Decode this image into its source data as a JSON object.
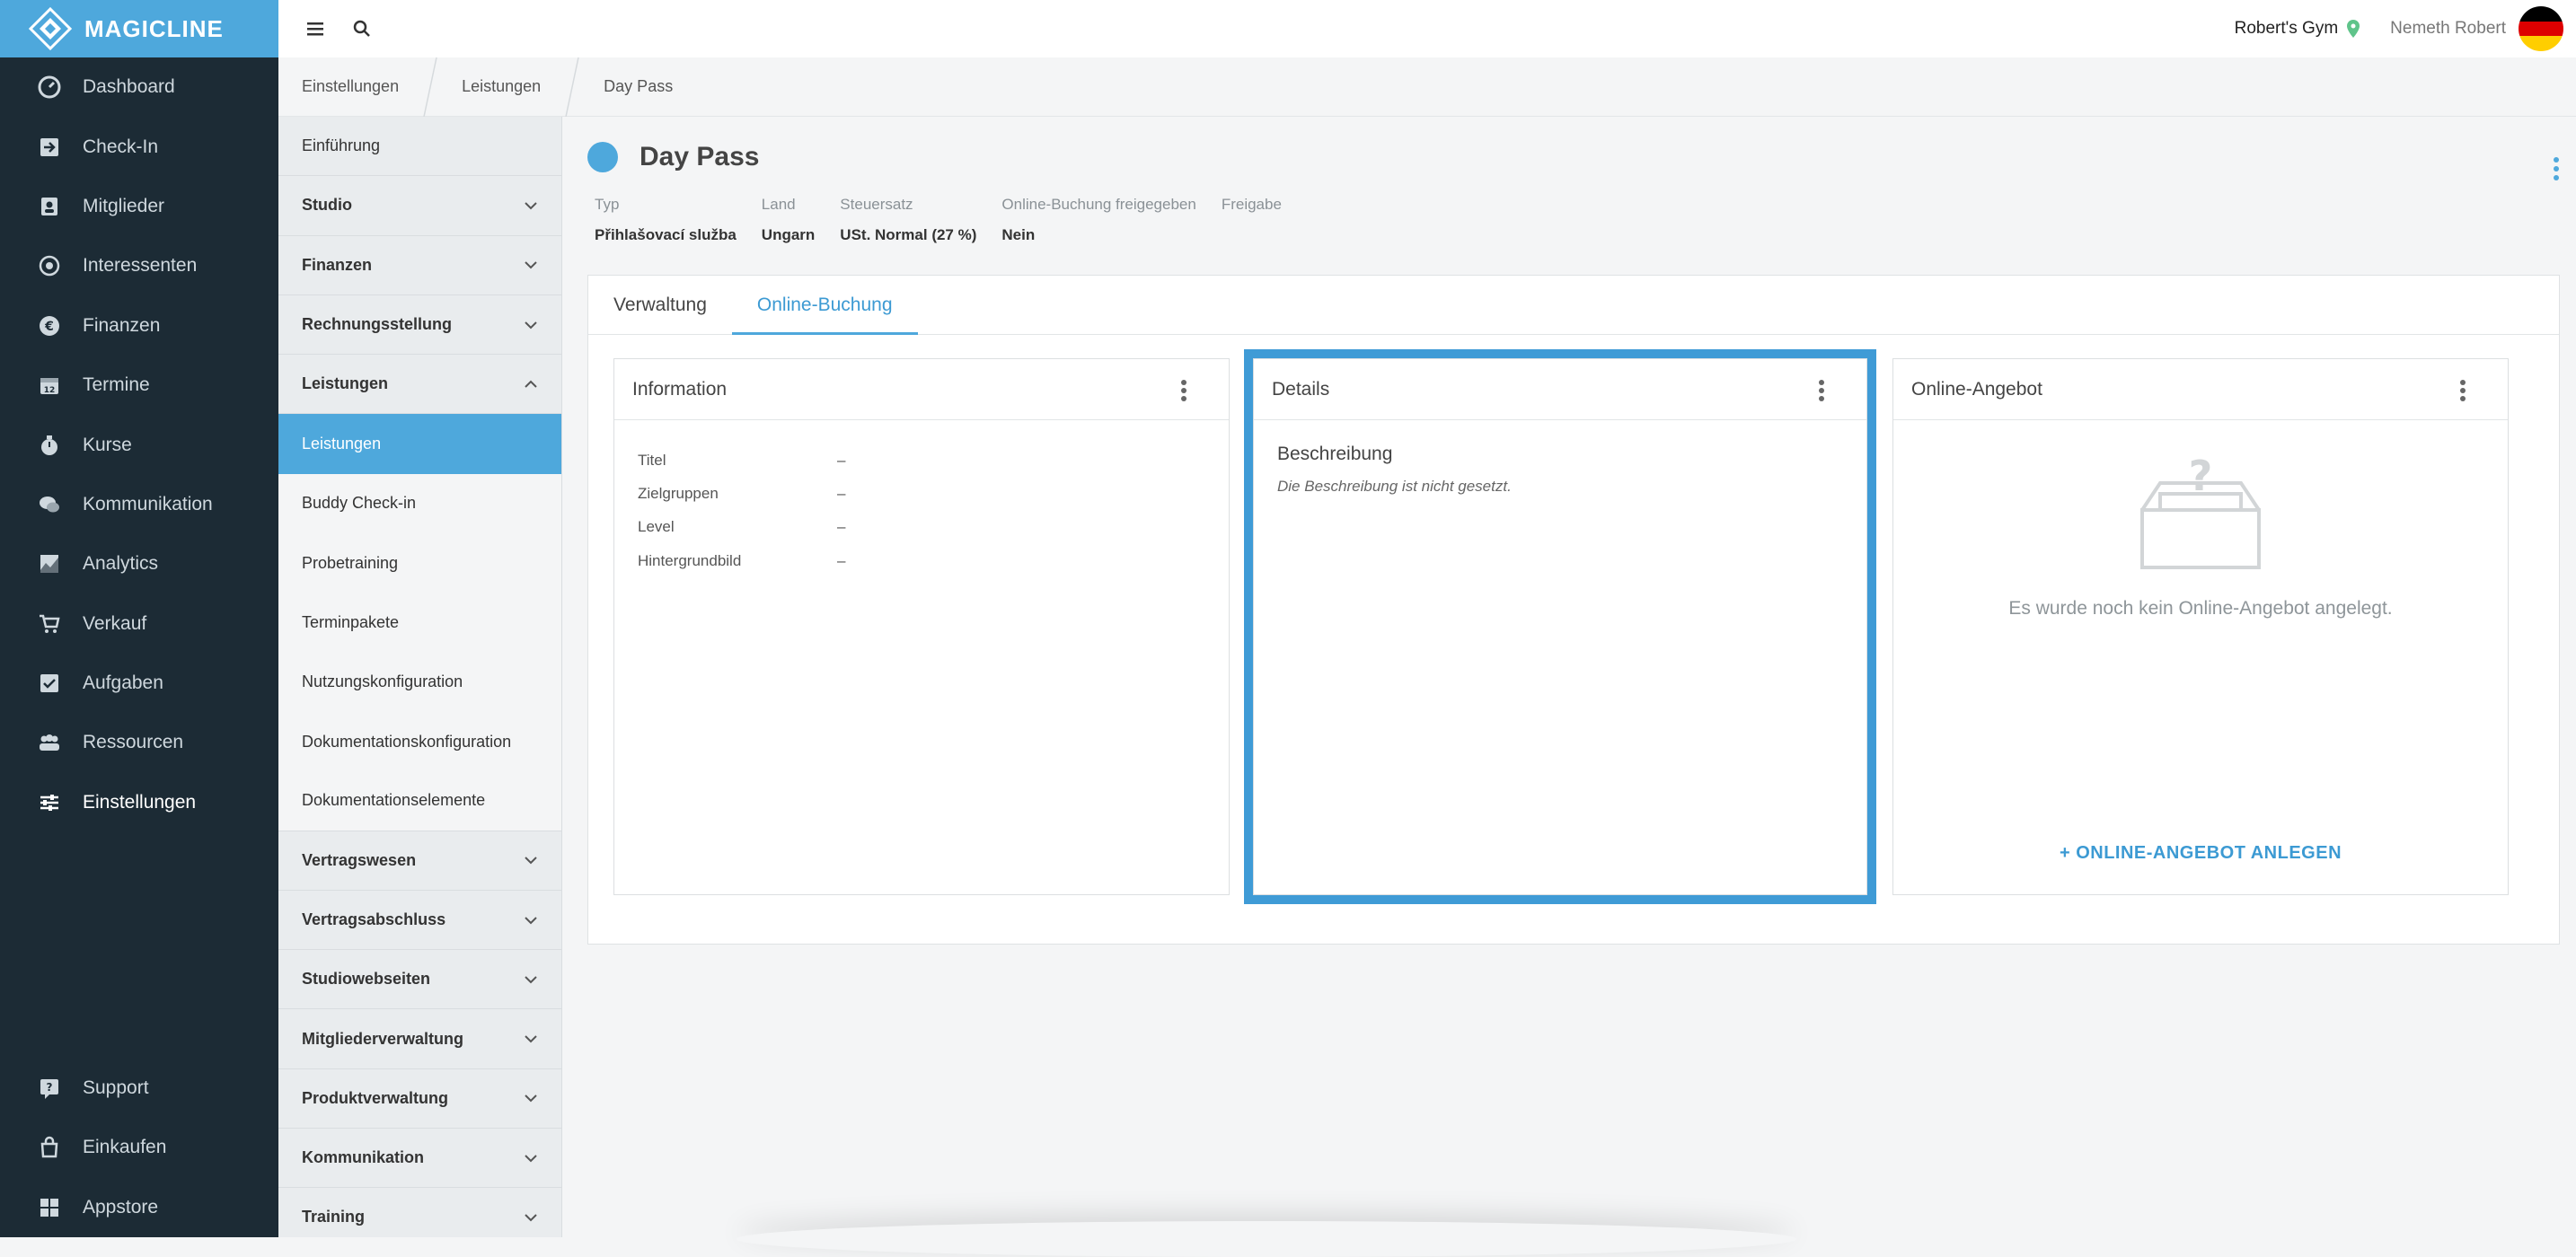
{
  "app": {
    "brand": "MAGICLINE"
  },
  "colors": {
    "accent": "#4ea8dc",
    "nav_bg": "#1c2b35",
    "link": "#3c9ad3"
  },
  "nav": {
    "items": [
      {
        "label": "Dashboard",
        "icon": "dashboard-icon"
      },
      {
        "label": "Check-In",
        "icon": "check-in-icon"
      },
      {
        "label": "Mitglieder",
        "icon": "members-icon"
      },
      {
        "label": "Interessenten",
        "icon": "prospects-icon"
      },
      {
        "label": "Finanzen",
        "icon": "euro-icon"
      },
      {
        "label": "Termine",
        "icon": "calendar-icon"
      },
      {
        "label": "Kurse",
        "icon": "courses-icon"
      },
      {
        "label": "Kommunikation",
        "icon": "chat-icon"
      },
      {
        "label": "Analytics",
        "icon": "analytics-icon"
      },
      {
        "label": "Verkauf",
        "icon": "cart-icon"
      },
      {
        "label": "Aufgaben",
        "icon": "tasks-icon"
      },
      {
        "label": "Ressourcen",
        "icon": "resources-icon"
      },
      {
        "label": "Einstellungen",
        "icon": "settings-icon"
      }
    ],
    "bottom": [
      {
        "label": "Support",
        "icon": "support-icon"
      },
      {
        "label": "Einkaufen",
        "icon": "shop-icon"
      },
      {
        "label": "Appstore",
        "icon": "appstore-icon"
      }
    ]
  },
  "topbar": {
    "gym": "Robert's Gym",
    "user": "Nemeth Robert"
  },
  "breadcrumb": [
    "Einstellungen",
    "Leistungen",
    "Day Pass"
  ],
  "subnav": {
    "items": [
      {
        "label": "Einführung"
      },
      {
        "label": "Studio"
      },
      {
        "label": "Finanzen"
      },
      {
        "label": "Rechnungsstellung"
      },
      {
        "label": "Leistungen"
      },
      {
        "label": "Leistungen"
      },
      {
        "label": "Buddy Check-in"
      },
      {
        "label": "Probetraining"
      },
      {
        "label": "Terminpakete"
      },
      {
        "label": "Nutzungskonfiguration"
      },
      {
        "label": "Dokumentationskonfiguration"
      },
      {
        "label": "Dokumentationselemente"
      },
      {
        "label": "Vertragswesen"
      },
      {
        "label": "Vertragsabschluss"
      },
      {
        "label": "Studiowebseiten"
      },
      {
        "label": "Mitgliederverwaltung"
      },
      {
        "label": "Produktverwaltung"
      },
      {
        "label": "Kommunikation"
      },
      {
        "label": "Training"
      }
    ]
  },
  "page": {
    "title": "Day Pass",
    "meta": [
      {
        "label": "Typ",
        "value": "Přihlašovací služba"
      },
      {
        "label": "Land",
        "value": "Ungarn"
      },
      {
        "label": "Steuersatz",
        "value": "USt. Normal (27 %)"
      },
      {
        "label": "Online-Buchung freigegeben",
        "value": "Nein"
      },
      {
        "label": "Freigabe",
        "value": ""
      }
    ],
    "tabs": [
      "Verwaltung",
      "Online-Buchung"
    ],
    "info_panel": {
      "title": "Information",
      "rows": [
        {
          "key": "Titel",
          "value": "–"
        },
        {
          "key": "Zielgruppen",
          "value": "–"
        },
        {
          "key": "Level",
          "value": "–"
        },
        {
          "key": "Hintergrundbild",
          "value": "–"
        }
      ]
    },
    "details_panel": {
      "title": "Details",
      "heading": "Beschreibung",
      "text": "Die Beschreibung ist nicht gesetzt."
    },
    "offer_panel": {
      "title": "Online-Angebot",
      "empty_text": "Es wurde noch kein Online-Angebot angelegt.",
      "create_label": "+ ONLINE-ANGEBOT ANLEGEN"
    }
  }
}
